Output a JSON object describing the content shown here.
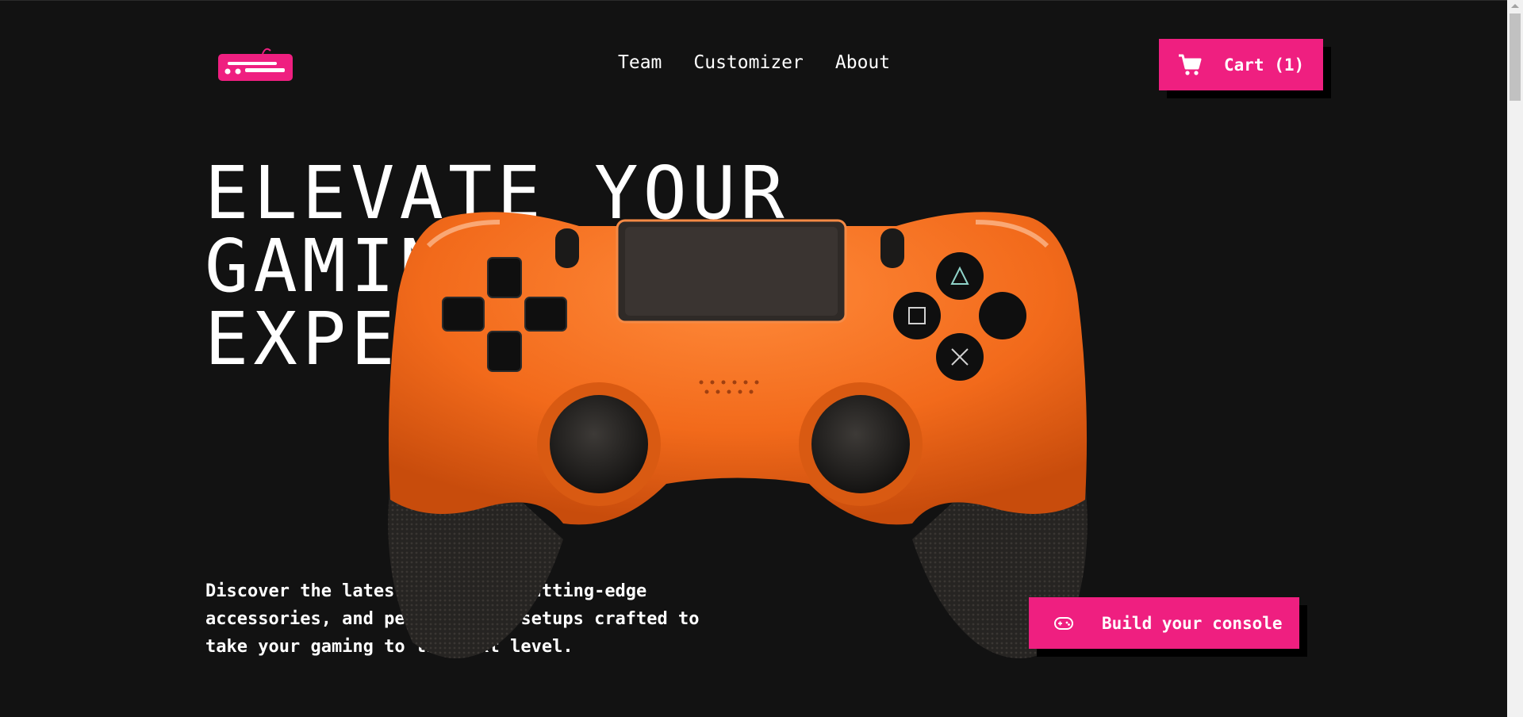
{
  "header": {
    "logo_icon": "console-logo-icon",
    "nav": [
      {
        "label": "Team"
      },
      {
        "label": "Customizer"
      },
      {
        "label": "About"
      }
    ],
    "cart": {
      "icon": "cart-icon",
      "label": "Cart (1)"
    }
  },
  "hero": {
    "title_lines": [
      "ELEVATE YOUR",
      "GAMING",
      "EXPERIENCE"
    ],
    "description": "Discover the latest consoles, cutting-edge accessories, and personalized setups crafted to take your gaming to the next level.",
    "image": "orange-game-controller",
    "cta": {
      "icon": "gamepad-icon",
      "label": "Build your console"
    }
  },
  "colors": {
    "background": "#121212",
    "accent": "#ef1f80",
    "text": "#ffffff",
    "controller_body": "#f26a1b"
  }
}
